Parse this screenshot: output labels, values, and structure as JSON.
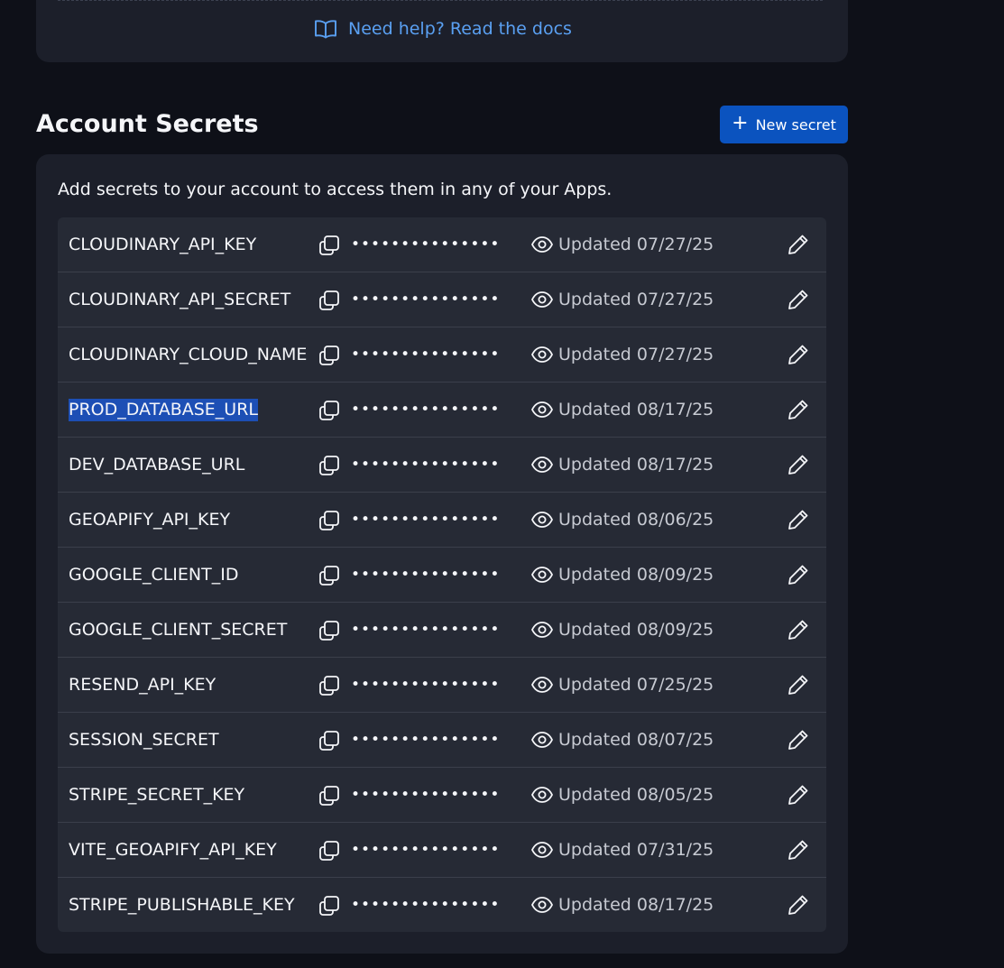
{
  "help": {
    "label": "Need help? Read the docs"
  },
  "section": {
    "title": "Account Secrets",
    "new_secret_label": "New secret"
  },
  "card": {
    "description": "Add secrets to your account to access them in any of your Apps."
  },
  "secrets": [
    {
      "name": "CLOUDINARY_API_KEY",
      "masked": "•••••••••••••••",
      "updated": "Updated 07/27/25",
      "selected": false
    },
    {
      "name": "CLOUDINARY_API_SECRET",
      "masked": "•••••••••••••••",
      "updated": "Updated 07/27/25",
      "selected": false
    },
    {
      "name": "CLOUDINARY_CLOUD_NAME",
      "masked": "•••••••••••••••",
      "updated": "Updated 07/27/25",
      "selected": false
    },
    {
      "name": "PROD_DATABASE_URL",
      "masked": "•••••••••••••••",
      "updated": "Updated 08/17/25",
      "selected": true
    },
    {
      "name": "DEV_DATABASE_URL",
      "masked": "•••••••••••••••",
      "updated": "Updated 08/17/25",
      "selected": false
    },
    {
      "name": "GEOAPIFY_API_KEY",
      "masked": "•••••••••••••••",
      "updated": "Updated 08/06/25",
      "selected": false
    },
    {
      "name": "GOOGLE_CLIENT_ID",
      "masked": "•••••••••••••••",
      "updated": "Updated 08/09/25",
      "selected": false
    },
    {
      "name": "GOOGLE_CLIENT_SECRET",
      "masked": "•••••••••••••••",
      "updated": "Updated 08/09/25",
      "selected": false
    },
    {
      "name": "RESEND_API_KEY",
      "masked": "•••••••••••••••",
      "updated": "Updated 07/25/25",
      "selected": false
    },
    {
      "name": "SESSION_SECRET",
      "masked": "•••••••••••••••",
      "updated": "Updated 08/07/25",
      "selected": false
    },
    {
      "name": "STRIPE_SECRET_KEY",
      "masked": "•••••••••••••••",
      "updated": "Updated 08/05/25",
      "selected": false
    },
    {
      "name": "VITE_GEOAPIFY_API_KEY",
      "masked": "•••••••••••••••",
      "updated": "Updated 07/31/25",
      "selected": false
    },
    {
      "name": "STRIPE_PUBLISHABLE_KEY",
      "masked": "•••••••••••••••",
      "updated": "Updated 08/17/25",
      "selected": false
    }
  ],
  "icons": {
    "help": "book-open-icon",
    "new_secret": "plus-icon",
    "copy": "copy-icon",
    "reveal": "eye-icon",
    "edit": "pencil-icon"
  },
  "colors": {
    "page_bg": "#0e1018",
    "card_bg": "#1c1f2a",
    "row_bg": "#262a35",
    "primary_button": "#0b53bf",
    "link": "#5aa0f2",
    "selection": "#1d4fb5"
  }
}
